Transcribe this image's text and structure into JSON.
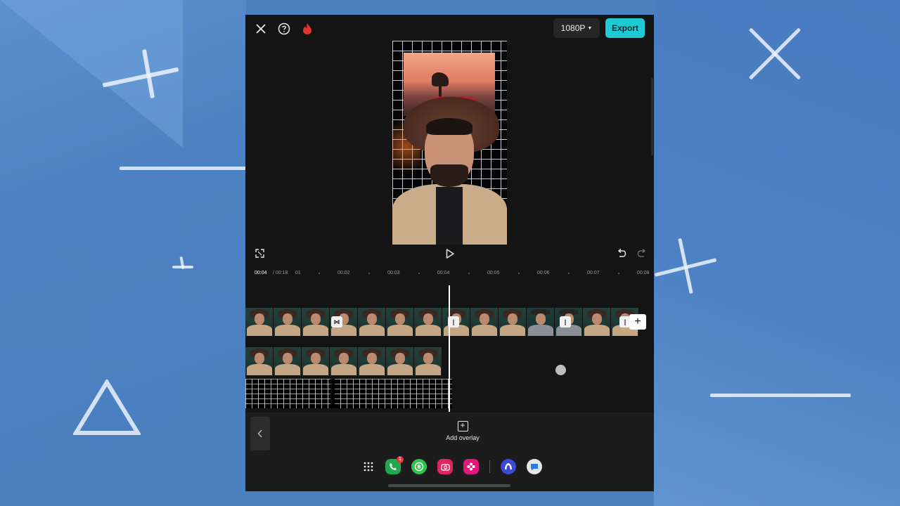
{
  "topbar": {
    "resolution_label": "1080P",
    "export_label": "Export"
  },
  "icons": {
    "close": "close-icon",
    "help": "help-icon",
    "fire": "fire-icon",
    "fullscreen": "fullscreen-icon",
    "play": "play-icon",
    "undo": "undo-icon",
    "redo": "redo-icon"
  },
  "ruler": {
    "current": "00:04",
    "total": "/ 00:18",
    "marks": [
      "01",
      "00:02",
      "00:03",
      "00:04",
      "00:05",
      "00:06",
      "00:07",
      "00:08"
    ]
  },
  "toolbar": {
    "add_overlay_label": "Add overlay"
  },
  "dock": {
    "phone_badge": "1"
  },
  "colors": {
    "accent": "#1ecad3",
    "background": "#141414",
    "page_bg": "#4a7fc0"
  }
}
